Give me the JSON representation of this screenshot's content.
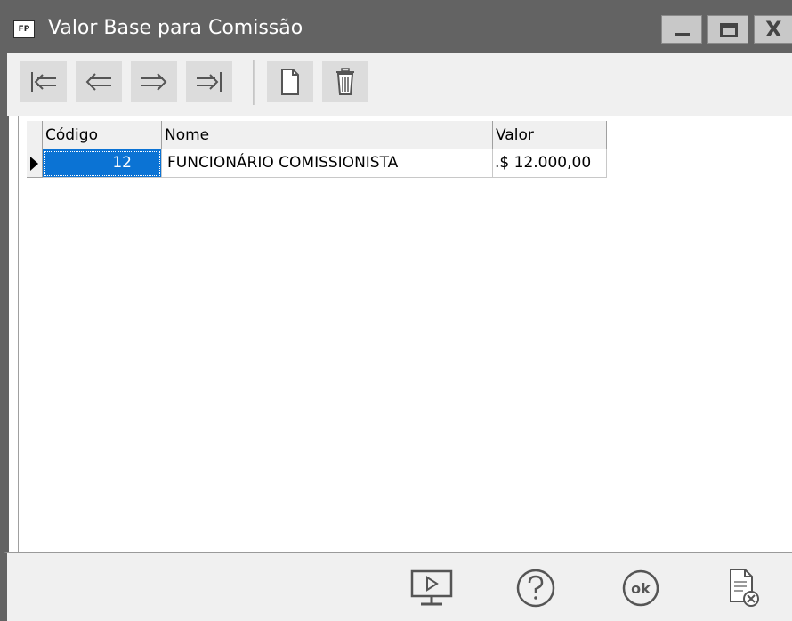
{
  "window": {
    "app_icon_text": "FP",
    "title": "Valor Base para Comissão"
  },
  "toolbar": {
    "buttons": [
      {
        "name": "first-record",
        "icon": "first-record-icon"
      },
      {
        "name": "previous-record",
        "icon": "arrow-left-icon"
      },
      {
        "name": "next-record",
        "icon": "arrow-right-icon"
      },
      {
        "name": "last-record",
        "icon": "last-record-icon"
      },
      {
        "name": "new-record",
        "icon": "new-document-icon"
      },
      {
        "name": "delete-record",
        "icon": "trash-icon"
      }
    ]
  },
  "grid": {
    "columns": [
      "Código",
      "Nome",
      "Valor"
    ],
    "rows": [
      {
        "codigo": "12",
        "nome": "FUNCIONÁRIO COMISSIONISTA",
        "valor": ".$ 12.000,00"
      }
    ],
    "selected_color": "#0b73d4"
  },
  "footer": {
    "buttons": [
      {
        "name": "preview",
        "icon": "monitor-play-icon"
      },
      {
        "name": "help",
        "icon": "help-icon"
      },
      {
        "name": "ok",
        "icon": "ok-icon",
        "label": "ok"
      },
      {
        "name": "cancel",
        "icon": "document-cancel-icon"
      }
    ]
  },
  "colors": {
    "titlebar": "#636363",
    "toolbar_bg": "#f0f0f0",
    "button_bg": "#dcdcdc"
  }
}
